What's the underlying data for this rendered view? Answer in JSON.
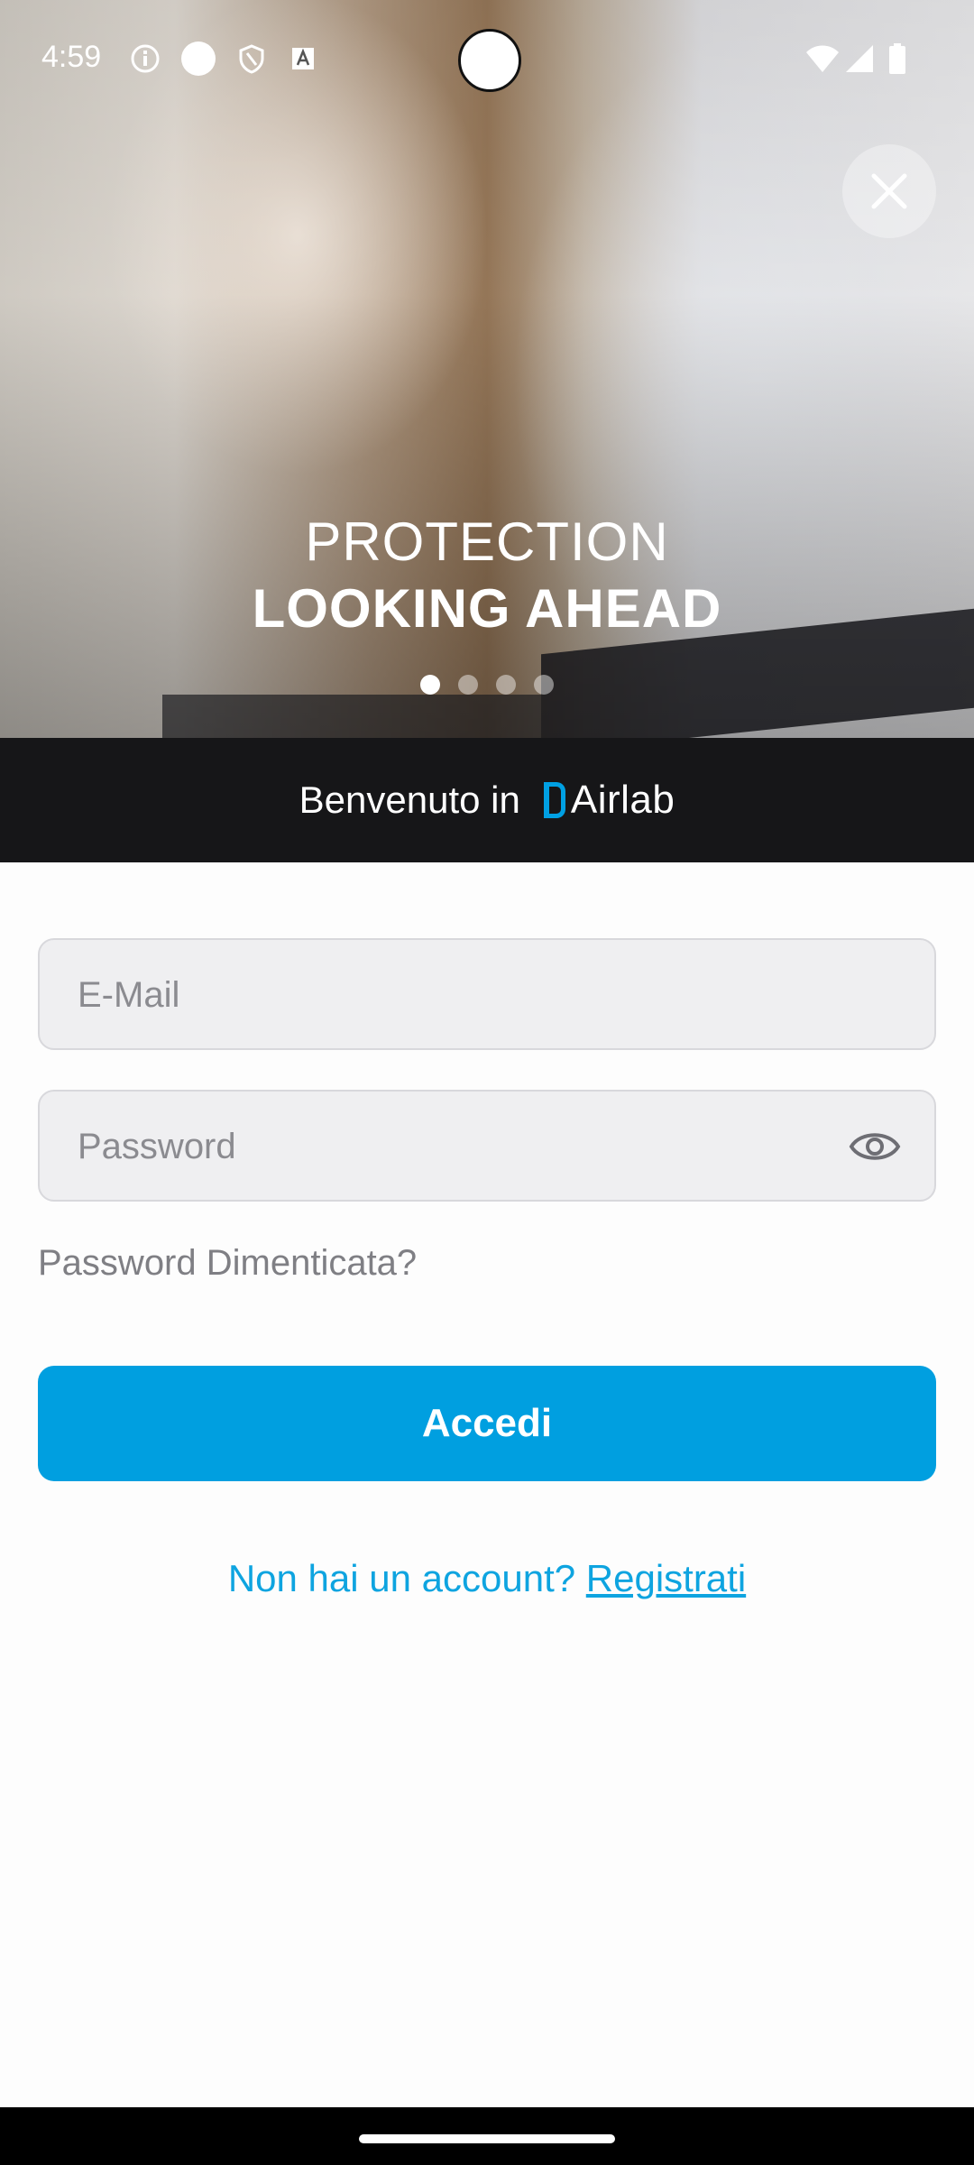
{
  "status_bar": {
    "time": "4:59",
    "icons_left": [
      "info-icon",
      "circle-icon",
      "shield-icon",
      "accessibility-icon"
    ],
    "icons_right": [
      "wifi-icon",
      "signal-icon",
      "battery-icon"
    ]
  },
  "hero": {
    "title_line1": "PROTECTION",
    "title_line2": "LOOKING AHEAD",
    "slides_total": 4,
    "active_slide": 1
  },
  "welcome": {
    "prefix": "Benvenuto in",
    "brand_name": "Airlab",
    "brand_color": "#00a0e3"
  },
  "form": {
    "email_placeholder": "E-Mail",
    "password_placeholder": "Password",
    "forgot_label": "Password Dimenticata?",
    "login_label": "Accedi",
    "login_color": "#009fe0"
  },
  "signup": {
    "prompt": "Non hai un account?",
    "link_label": "Registrati"
  }
}
